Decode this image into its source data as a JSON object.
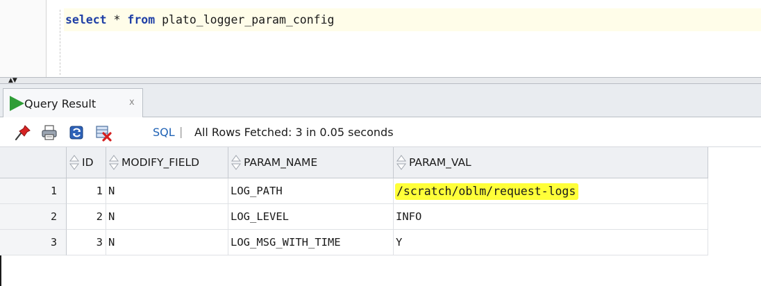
{
  "editor": {
    "keyword_select": "select",
    "star": " * ",
    "keyword_from": "from",
    "table_name": " plato_logger_param_config"
  },
  "tab": {
    "label": "Query Result",
    "close_label": "x"
  },
  "toolbar": {
    "icons": [
      "pin-icon",
      "print-icon",
      "refresh-icon",
      "cancel-icon"
    ],
    "sql_label": "SQL",
    "separator": "|",
    "status": "All Rows Fetched: 3 in 0.05 seconds"
  },
  "grid": {
    "columns": [
      "ID",
      "MODIFY_FIELD",
      "PARAM_NAME",
      "PARAM_VAL"
    ],
    "rows": [
      {
        "num": "1",
        "id": "1",
        "modify_field": "N",
        "param_name": "LOG_PATH",
        "param_val": "/scratch/oblm/request-logs"
      },
      {
        "num": "2",
        "id": "2",
        "modify_field": "N",
        "param_name": "LOG_LEVEL",
        "param_val": "INFO"
      },
      {
        "num": "3",
        "id": "3",
        "modify_field": "N",
        "param_name": "LOG_MSG_WITH_TIME",
        "param_val": "Y"
      }
    ]
  },
  "colors": {
    "highlight": "#ffff39",
    "keyword": "#1f3fa6",
    "run_icon": "#2f9d37",
    "sql_link": "#1f62b5"
  }
}
